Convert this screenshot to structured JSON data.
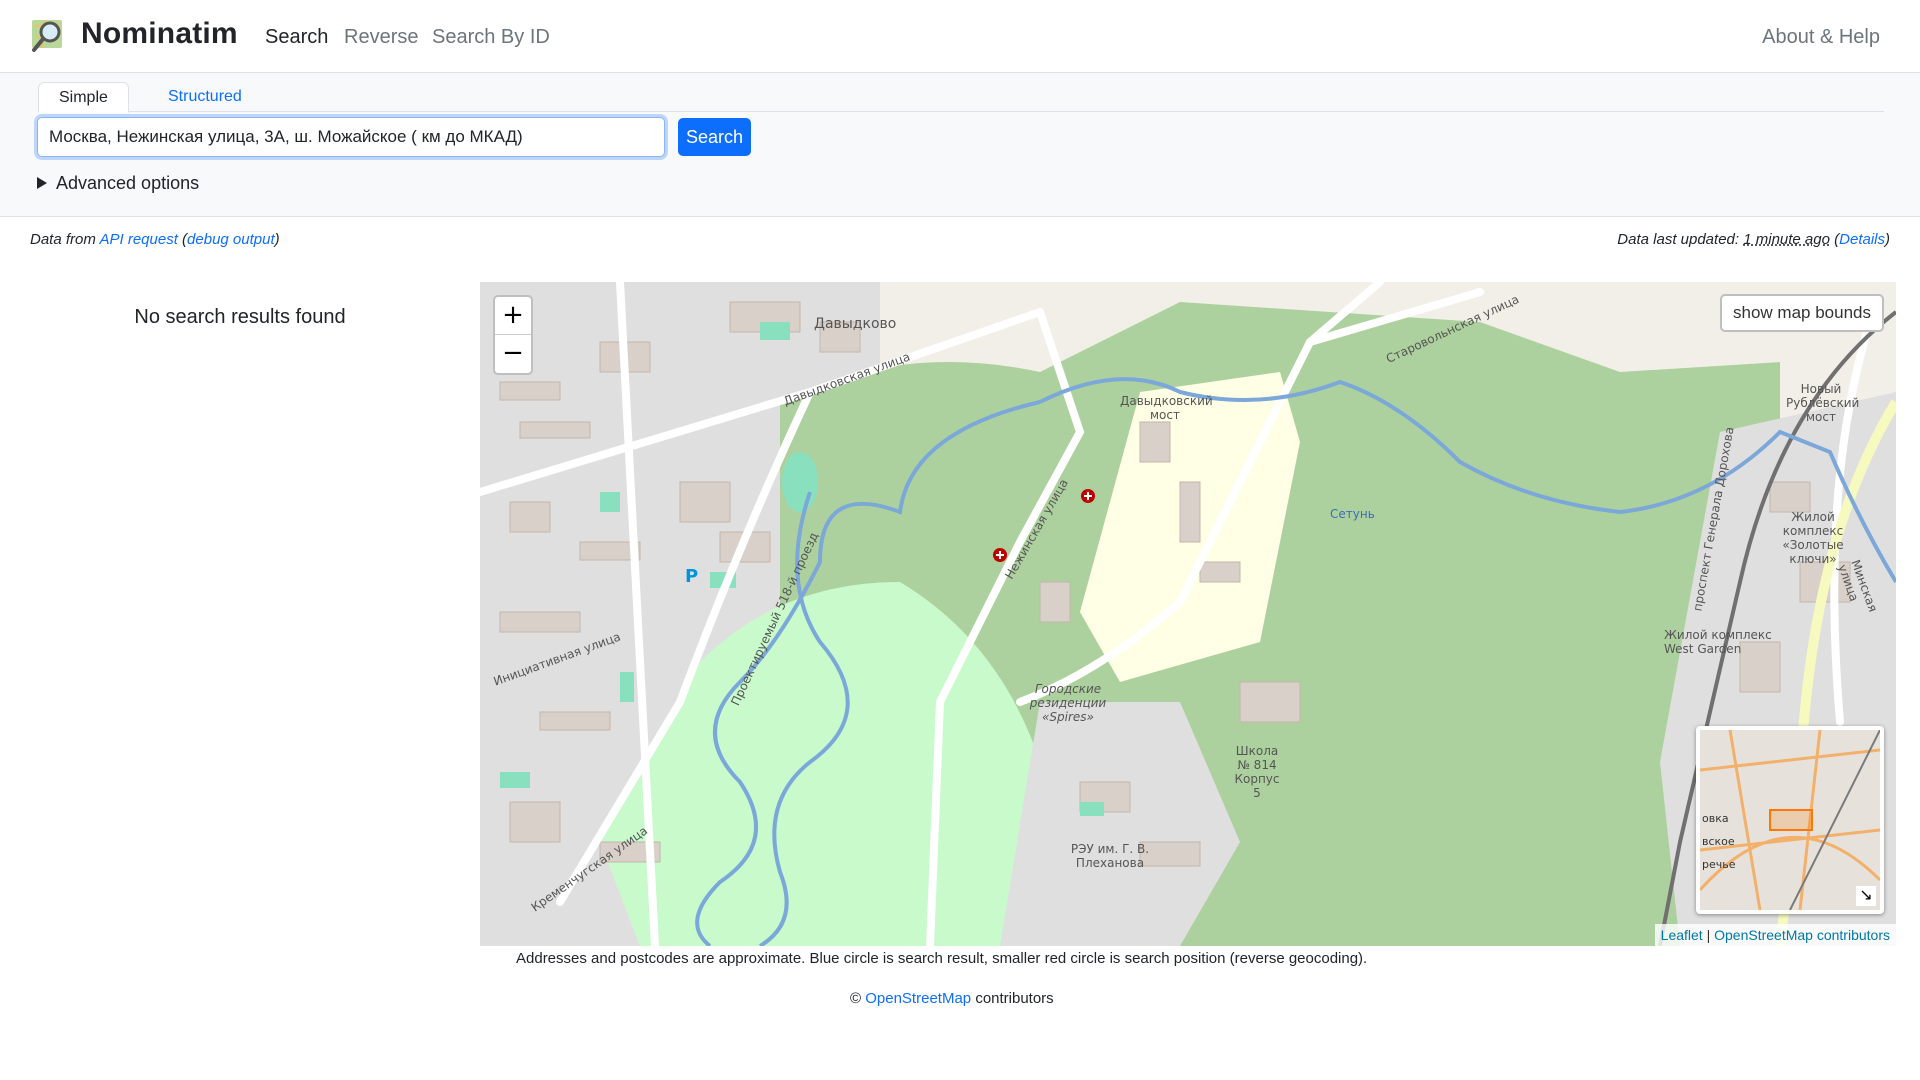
{
  "header": {
    "brand": "Nominatim",
    "nav": [
      {
        "label": "Search",
        "active": true
      },
      {
        "label": "Reverse",
        "active": false
      },
      {
        "label": "Search By ID",
        "active": false
      }
    ],
    "about": "About & Help"
  },
  "search": {
    "tabs": [
      "Simple",
      "Structured"
    ],
    "active_tab": "Simple",
    "query_value": "Москва, Нежинская улица, 3А, ш. Можайское ( км до МКАД)",
    "button_label": "Search",
    "advanced_label": "Advanced options"
  },
  "status": {
    "data_from_prefix": "Data from",
    "api_request": "API request",
    "debug_output": "debug output",
    "updated_prefix": "Data last updated:",
    "updated_value": "1 minute ago",
    "details": "Details"
  },
  "results": {
    "message": "No search results found"
  },
  "map": {
    "zoom_in": "+",
    "zoom_out": "−",
    "bounds_button": "show map bounds",
    "attribution_leaflet": "Leaflet",
    "attribution_osm": "OpenStreetMap contributors",
    "labels": {
      "davydkovo": "Давыдково",
      "davydkovskaya_street": "Давыдковская улица",
      "davydkovsky_bridge": "Давыдковский мост",
      "staravolynskaya": "Старовольнская улица",
      "new_rublevsky": "Новый Рублёвский мост",
      "nezhinskaya": "Нежинская улица",
      "setun": "Сетунь",
      "gen_dorokhova": "проспект Генерала Дорохова",
      "minskaya": "Минская улица",
      "west_garden": "Жилой комплекс West Garden",
      "zolotye_klyuchi": "Жилой комплекс «Золотые ключи»",
      "spires": "Городские резиденции «Spires»",
      "school": "Школа № 814 Корпус 5",
      "plekhanov": "РЭУ им. Г. В. Плеханова",
      "kremenchugskaya": "Кременчугская улица",
      "initsiativnaya": "Инициативная улица",
      "proezd": "Проектируемый 518-й проезд",
      "minimap_1": "овка",
      "minimap_2": "вское",
      "minimap_3": "речье"
    },
    "note": "Addresses and postcodes are approximate. Blue circle is search result, smaller red circle is search position (reverse geocoding)."
  },
  "footer": {
    "copyright_symbol": "©",
    "osm": "OpenStreetMap",
    "contributors": "contributors"
  }
}
